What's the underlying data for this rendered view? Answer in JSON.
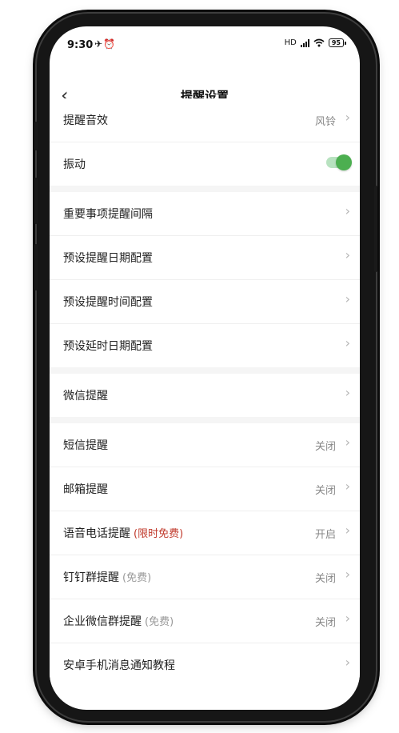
{
  "status_bar": {
    "time": "9:30",
    "icons": "✈⏰",
    "network": "HD",
    "battery": "95",
    "icon_names": [
      "airplane-mode-icon",
      "alarm-icon",
      "signal-icon",
      "wifi-icon",
      "battery-icon"
    ]
  },
  "nav": {
    "back_label": "‹",
    "title": "提醒设置"
  },
  "sections": {
    "general": {
      "sound": {
        "label": "提醒音效",
        "value": "风铃"
      },
      "vibration": {
        "label": "振动",
        "enabled": true,
        "accent": "#4caf50"
      }
    },
    "presets": {
      "items": [
        {
          "label": "重要事项提醒间隔"
        },
        {
          "label": "预设提醒日期配置"
        },
        {
          "label": "预设提醒时间配置"
        },
        {
          "label": "预设延时日期配置"
        }
      ]
    },
    "wechat": {
      "label": "微信提醒"
    },
    "channels": {
      "items": [
        {
          "label": "短信提醒",
          "tag": "",
          "value": "关闭"
        },
        {
          "label": "邮箱提醒",
          "tag": "",
          "value": "关闭"
        },
        {
          "label": "语音电话提醒",
          "tag": "(限时免费)",
          "tag_color": "#c0392b",
          "value": "开启"
        },
        {
          "label": "钉钉群提醒",
          "tag": "(免费)",
          "tag_color": "#999999",
          "value": "关闭"
        },
        {
          "label": "企业微信群提醒",
          "tag": "(免费)",
          "tag_color": "#999999",
          "value": "关闭"
        }
      ]
    },
    "tutorial": {
      "label": "安卓手机消息通知教程"
    }
  },
  "chevron_glyph": "›"
}
